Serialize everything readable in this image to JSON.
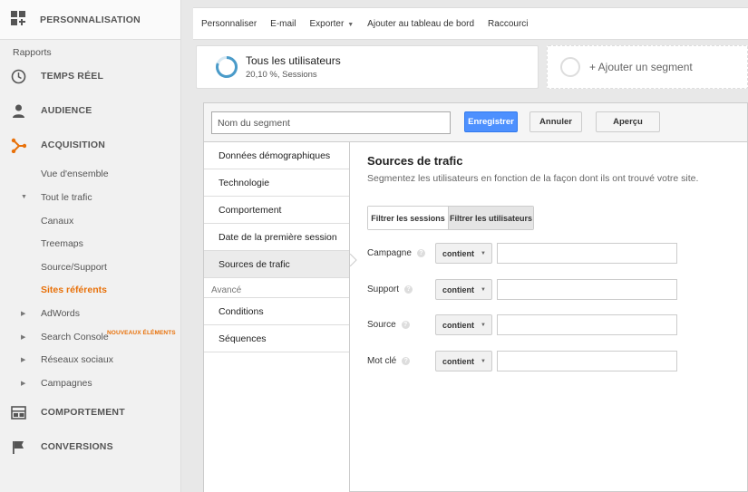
{
  "sidebar": {
    "top_item": "PERSONNALISATION",
    "section_label": "Rapports",
    "main_items": [
      {
        "label": "TEMPS RÉEL",
        "icon": "clock-icon"
      },
      {
        "label": "AUDIENCE",
        "icon": "person-icon"
      },
      {
        "label": "ACQUISITION",
        "icon": "acquisition-icon"
      },
      {
        "label": "COMPORTEMENT",
        "icon": "behavior-icon"
      },
      {
        "label": "CONVERSIONS",
        "icon": "flag-icon"
      }
    ],
    "acq_sub": {
      "overview": "Vue d'ensemble",
      "all_traffic": "Tout le trafic",
      "channels": "Canaux",
      "treemaps": "Treemaps",
      "source_medium": "Source/Support",
      "referrals": "Sites référents",
      "adwords": "AdWords",
      "search_console": "Search Console",
      "social": "Réseaux sociaux",
      "campaigns": "Campagnes"
    },
    "new_badge": "NOUVEAUX ÉLÉMENTS",
    "accent": "#e8710a"
  },
  "toolbar": {
    "customize": "Personnaliser",
    "email": "E-mail",
    "export": "Exporter",
    "dashboard": "Ajouter au tableau de bord",
    "shortcut": "Raccourci"
  },
  "segments": {
    "active_title": "Tous les utilisateurs",
    "active_sub": "20,10 %, Sessions",
    "add_label": "+ Ajouter un segment"
  },
  "editor": {
    "name_placeholder": "Nom du segment",
    "save": "Enregistrer",
    "cancel": "Annuler",
    "preview": "Aperçu",
    "nav": {
      "demographics": "Données démographiques",
      "technology": "Technologie",
      "behavior": "Comportement",
      "first_session": "Date de la première session",
      "traffic_sources": "Sources de trafic",
      "advanced": "Avancé",
      "conditions": "Conditions",
      "sequences": "Séquences"
    },
    "content": {
      "title": "Sources de trafic",
      "description": "Segmentez les utilisateurs en fonction de la façon dont ils ont trouvé votre site.",
      "filter_sessions": "Filtrer les sessions",
      "filter_users": "Filtrer les utilisateurs",
      "filters": [
        {
          "label": "Campagne",
          "operator": "contient",
          "value": ""
        },
        {
          "label": "Support",
          "operator": "contient",
          "value": ""
        },
        {
          "label": "Source",
          "operator": "contient",
          "value": ""
        },
        {
          "label": "Mot clé",
          "operator": "contient",
          "value": ""
        }
      ]
    },
    "accent": "#4d90fe"
  }
}
